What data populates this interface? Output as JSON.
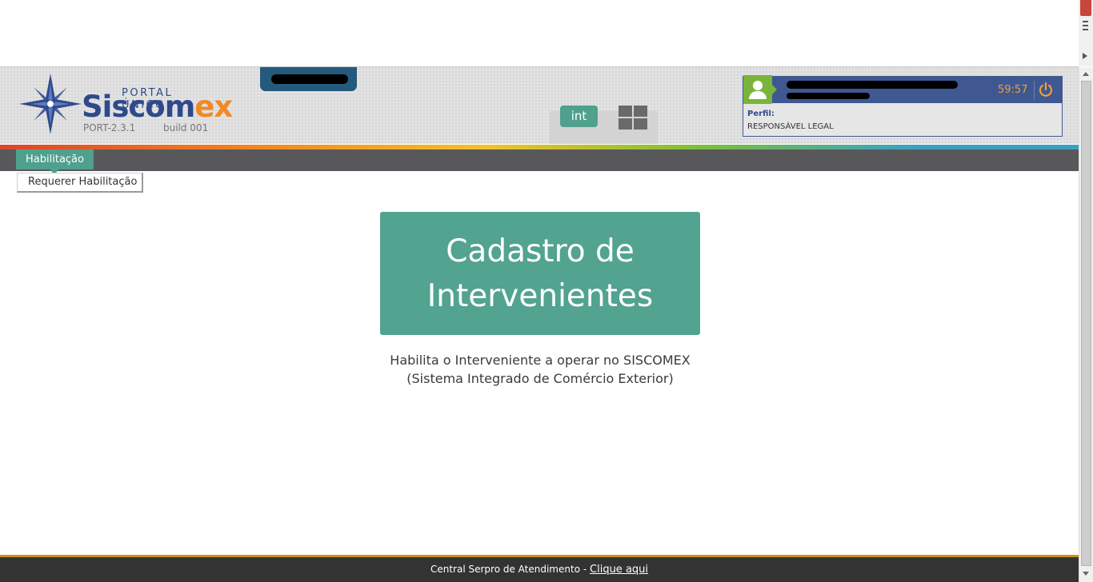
{
  "header": {
    "logo_portal": "PORTAL ÚNICO",
    "logo_brand_main": "Siscom",
    "logo_brand_accent": "ex",
    "version": "PORT-2.3.1",
    "build": "build 001",
    "int_label": "int"
  },
  "user_panel": {
    "timer": "59:57",
    "profile_label": "Perfil:",
    "profile_value": "RESPONSÁVEL LEGAL"
  },
  "menu": {
    "active_tab": "Habilitação",
    "submenu_item": "Requerer Habilitação"
  },
  "main": {
    "card_line1": "Cadastro de",
    "card_line2": "Intervenientes",
    "desc_line1": "Habilita o Interveniente a operar no SISCOMEX",
    "desc_line2": "(Sistema Integrado de Comércio Exterior)"
  },
  "footer": {
    "text": "Central Serpro de Atendimento -",
    "link": "Clique aqui"
  },
  "colors": {
    "accent_green": "#52a390",
    "brand_blue": "#2e4a8c",
    "brand_orange": "#f08a24",
    "menu_bar": "#58585a",
    "footer": "#333333"
  }
}
